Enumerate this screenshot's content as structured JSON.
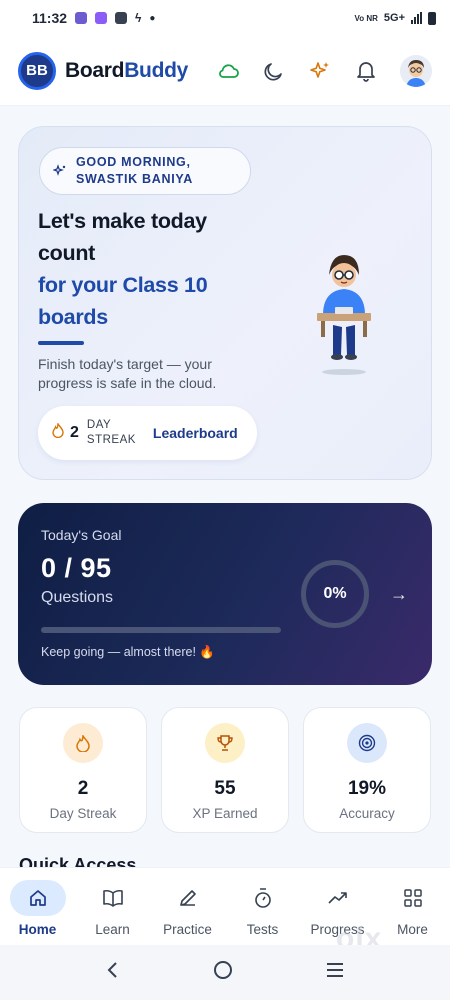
{
  "status_bar": {
    "time": "11:32",
    "network": "5G+",
    "volte": "Vo NR"
  },
  "header": {
    "logo_text": "BB",
    "brand_part1": "Board",
    "brand_part2": "Buddy",
    "icons": [
      "cloud-icon",
      "moon-icon",
      "sparkle-icon",
      "bell-icon",
      "avatar"
    ]
  },
  "hero": {
    "greeting_line1": "GOOD MORNING,",
    "greeting_line2": "SWASTIK BANIYA",
    "title_line1": "Let's make today",
    "title_line2": "count",
    "title_blue_line1": "for your Class 10",
    "title_blue_line2": "boards",
    "subtitle": "Finish today's target — your progress is safe in the cloud.",
    "streak_value": "2",
    "streak_label": "DAY STREAK",
    "leaderboard_label": "Leaderboard"
  },
  "goal": {
    "label": "Today's Goal",
    "count": "0 / 95",
    "unit": "Questions",
    "progress": 0,
    "percent_text": "0%",
    "message": "Keep going — almost there! 🔥"
  },
  "stats": [
    {
      "value": "2",
      "label": "Day Streak",
      "icon": "flame-icon",
      "bg": "#fdecd3"
    },
    {
      "value": "55",
      "label": "XP Earned",
      "icon": "trophy-icon",
      "bg": "#fdf0c6"
    },
    {
      "value": "19%",
      "label": "Accuracy",
      "icon": "target-icon",
      "bg": "#dbe8fb"
    }
  ],
  "quick_access": "Quick Access",
  "bottom_nav": [
    {
      "label": "Home",
      "icon": "home-icon",
      "active": true
    },
    {
      "label": "Learn",
      "icon": "book-icon",
      "active": false
    },
    {
      "label": "Practice",
      "icon": "pencil-icon",
      "active": false
    },
    {
      "label": "Tests",
      "icon": "stopwatch-icon",
      "active": false
    },
    {
      "label": "Progress",
      "icon": "trend-icon",
      "active": false
    },
    {
      "label": "More",
      "icon": "grid-icon",
      "active": false
    }
  ],
  "watermark": "olx",
  "colors": {
    "accent": "#1e4aa8",
    "goal_bg": "#1d2a5a"
  }
}
